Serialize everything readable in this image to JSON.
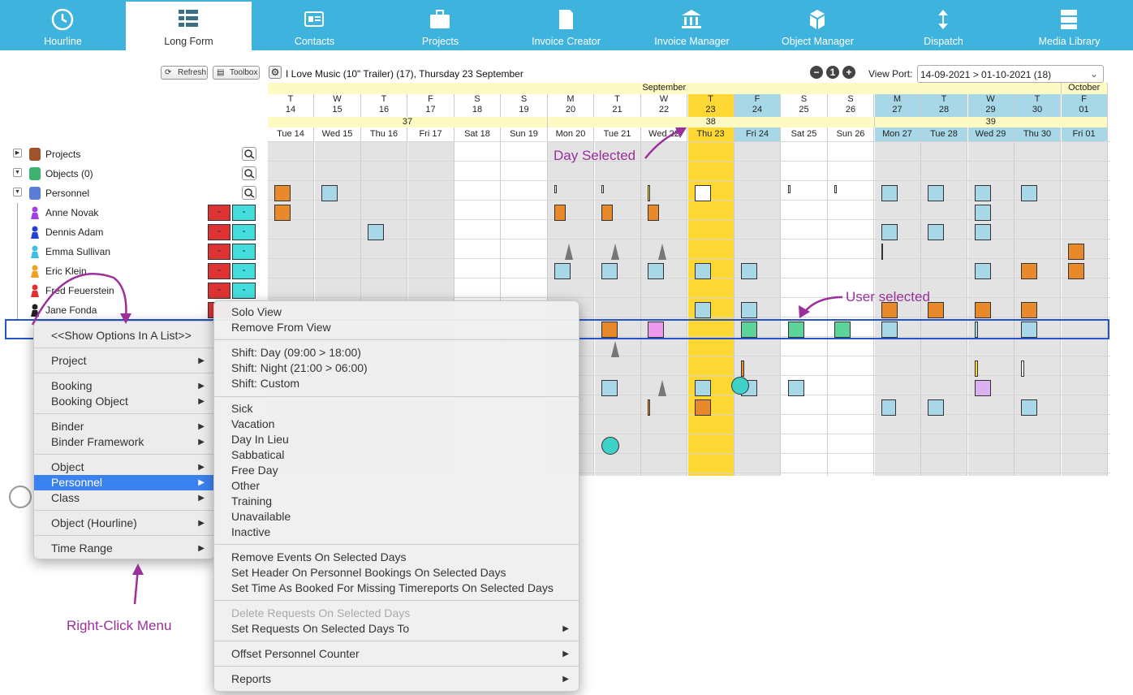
{
  "nav": [
    {
      "label": "Hourline",
      "icon": "clock-icon"
    },
    {
      "label": "Long Form",
      "icon": "long-form-icon",
      "active": true
    },
    {
      "label": "Contacts",
      "icon": "contacts-icon"
    },
    {
      "label": "Projects",
      "icon": "briefcase-icon"
    },
    {
      "label": "Invoice Creator",
      "icon": "invoice-icon"
    },
    {
      "label": "Invoice Manager",
      "icon": "bank-icon"
    },
    {
      "label": "Object Manager",
      "icon": "cubes-icon"
    },
    {
      "label": "Dispatch",
      "icon": "dispatch-icon"
    },
    {
      "label": "Media Library",
      "icon": "server-icon"
    }
  ],
  "toolbar": {
    "refresh": "Refresh",
    "toolbox": "Toolbox",
    "title": "I Love Music (10\" Trailer) (17),  Thursday 23 September",
    "viewport_label": "View Port:",
    "viewport_value": "14-09-2021 > 01-10-2021 (18)"
  },
  "calendar": {
    "months": [
      "September",
      "October"
    ],
    "weeks": [
      "37",
      "38",
      "39"
    ],
    "days": [
      [
        "T",
        "14",
        "Tue 14"
      ],
      [
        "W",
        "15",
        "Wed 15"
      ],
      [
        "T",
        "16",
        "Thu 16"
      ],
      [
        "F",
        "17",
        "Fri 17"
      ],
      [
        "S",
        "18",
        "Sat 18"
      ],
      [
        "S",
        "19",
        "Sun 19"
      ],
      [
        "M",
        "20",
        "Mon 20"
      ],
      [
        "T",
        "21",
        "Tue 21"
      ],
      [
        "W",
        "22",
        "Wed 22"
      ],
      [
        "T",
        "23",
        "Thu 23"
      ],
      [
        "F",
        "24",
        "Fri 24"
      ],
      [
        "S",
        "25",
        "Sat 25"
      ],
      [
        "S",
        "26",
        "Sun 26"
      ],
      [
        "M",
        "27",
        "Mon 27"
      ],
      [
        "T",
        "28",
        "Tue 28"
      ],
      [
        "W",
        "29",
        "Wed 29"
      ],
      [
        "T",
        "30",
        "Thu 30"
      ],
      [
        "F",
        "01",
        "Fri 01"
      ]
    ]
  },
  "tree": {
    "groups": [
      "Projects",
      "Objects (0)",
      "Personnel"
    ],
    "people": [
      "Anne Novak",
      "Dennis Adam",
      "Emma Sullivan",
      "Eric Klein",
      "Fred Feuerstein",
      "Jane Fonda"
    ],
    "red_cell": "-",
    "cyan_cell": "-"
  },
  "menu1": {
    "items": [
      "<<Show Options In A List>>",
      "Project",
      "Booking",
      "Booking Object",
      "Binder",
      "Binder Framework",
      "Object",
      "Personnel",
      "Class",
      "Object (Hourline)",
      "Time Range"
    ]
  },
  "menu2": {
    "items": [
      "Solo View",
      "Remove From View",
      "Shift: Day (09:00 > 18:00)",
      "Shift: Night (21:00 > 06:00)",
      "Shift: Custom",
      "Sick",
      "Vacation",
      "Day In Lieu",
      "Sabbatical",
      "Free Day",
      "Other",
      "Training",
      "Unavailable",
      "Inactive",
      "Remove Events On Selected Days",
      "Set Header On Personnel Bookings On Selected Days",
      "Set Time As Booked For Missing Timereports On Selected Days",
      "Delete Requests On Selected Days",
      "Set Requests On Selected Days To",
      "Offset Personnel Counter",
      "Reports"
    ]
  },
  "annotations": {
    "day_selected": "Day Selected",
    "user_selected": "User selected",
    "right_click": "Right-Click Menu"
  },
  "colors": {
    "nav": "#3db3de",
    "selected_day": "#fdd835",
    "highlight_col": "#a8d8e8",
    "weekend": "#ffffff",
    "weekday": "#e3e3e3",
    "annotation": "#9b2f9c",
    "menu_selected": "#3a82f0"
  }
}
